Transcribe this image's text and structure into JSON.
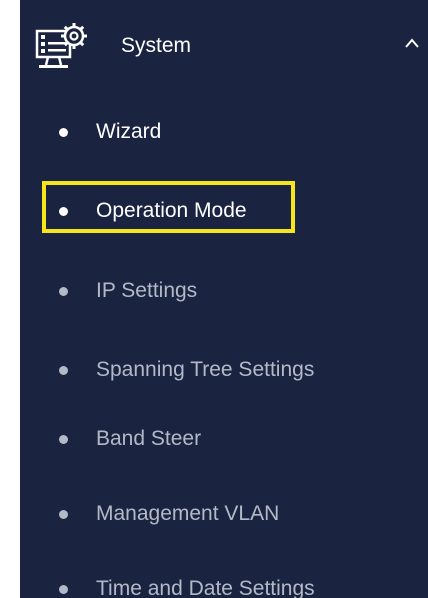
{
  "group": {
    "label": "System",
    "expanded": true,
    "icon": "system-monitor-gear-icon",
    "chevron_icon": "chevron-up-icon"
  },
  "items": [
    {
      "label": "Wizard",
      "state": "normal"
    },
    {
      "label": "Operation Mode",
      "state": "selected"
    },
    {
      "label": "IP Settings",
      "state": "dimmed"
    },
    {
      "label": "Spanning Tree Settings",
      "state": "dimmed"
    },
    {
      "label": "Band Steer",
      "state": "dimmed"
    },
    {
      "label": "Management VLAN",
      "state": "dimmed"
    },
    {
      "label": "Time and Date Settings",
      "state": "dimmed"
    }
  ],
  "colors": {
    "sidebar_bg": "#1a2440",
    "text_active": "#ffffff",
    "text_dimmed": "#b3b9c7",
    "highlight": "#f6e51a"
  }
}
